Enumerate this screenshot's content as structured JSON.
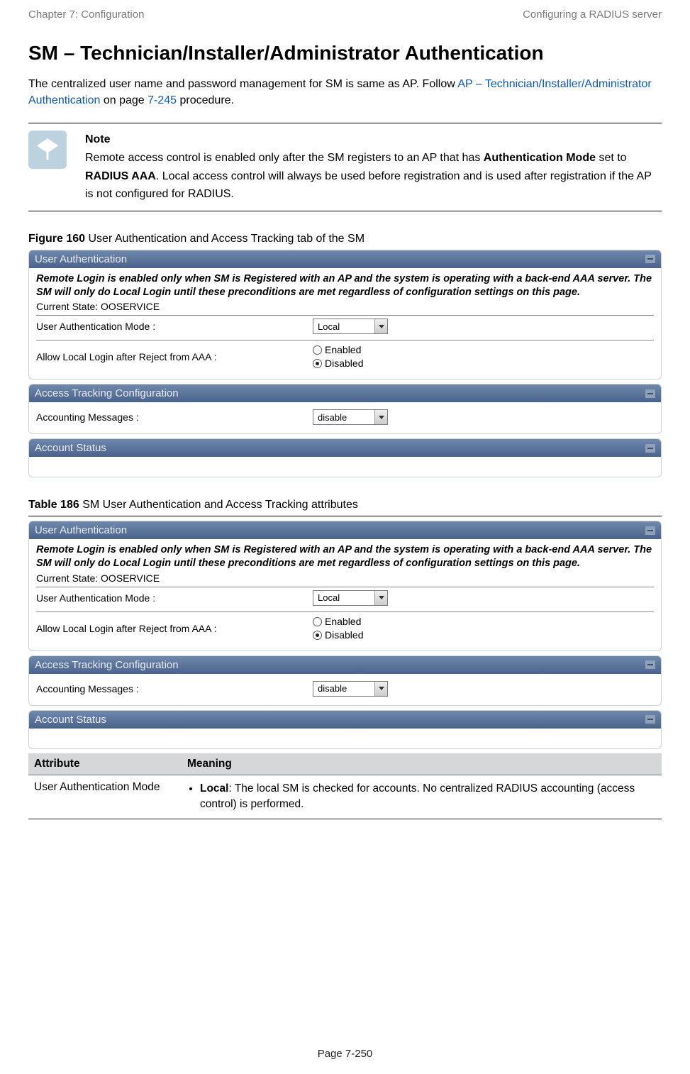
{
  "header": {
    "left": "Chapter 7:  Configuration",
    "right": "Configuring a RADIUS server"
  },
  "title": "SM – Technician/Installer/Administrator Authentication",
  "intro": {
    "pre_link": "The centralized user name and password management for SM is same as AP. Follow ",
    "link1": "AP – Technician/Installer/Administrator Authentication",
    "mid1": " on page ",
    "link2": "7-245",
    "post": " procedure."
  },
  "note": {
    "heading": "Note",
    "seg1": "Remote access control is enabled only after the SM registers to an AP that has ",
    "bold1": "Authentication Mode",
    "seg2": " set to ",
    "bold2": "RADIUS AAA",
    "seg3": ". Local access control will always be used before registration and is used after registration if the AP is not configured for RADIUS."
  },
  "figure": {
    "label": "Figure 160",
    "text": " User Authentication and Access Tracking tab of the SM"
  },
  "table_caption": {
    "label": "Table 186",
    "text": " SM User Authentication and Access Tracking attributes"
  },
  "ui": {
    "panel1_title": "User Authentication",
    "panel2_title": "Access Tracking Configuration",
    "panel3_title": "Account Status",
    "remote_note": "Remote Login is enabled only when SM is Registered with an AP and the system is operating with a back-end AAA server. The SM will only do Local Login until these preconditions are met regardless of configuration settings on this page.",
    "state": "Current State: OOSERVICE",
    "row1_label": "User Authentication Mode :",
    "row1_value": "Local",
    "row2_label": "Allow Local Login after Reject from AAA :",
    "row2_opt_enabled": "Enabled",
    "row2_opt_disabled": "Disabled",
    "acct_label": "Accounting Messages :",
    "acct_value": "disable"
  },
  "attr_table": {
    "head_attr": "Attribute",
    "head_meaning": "Meaning",
    "row_attr": "User Authentication Mode",
    "row_bullet_bold": "Local",
    "row_bullet_rest": ": The local SM is checked for accounts. No centralized RADIUS accounting (access control) is performed."
  },
  "footer": "Page 7-250"
}
